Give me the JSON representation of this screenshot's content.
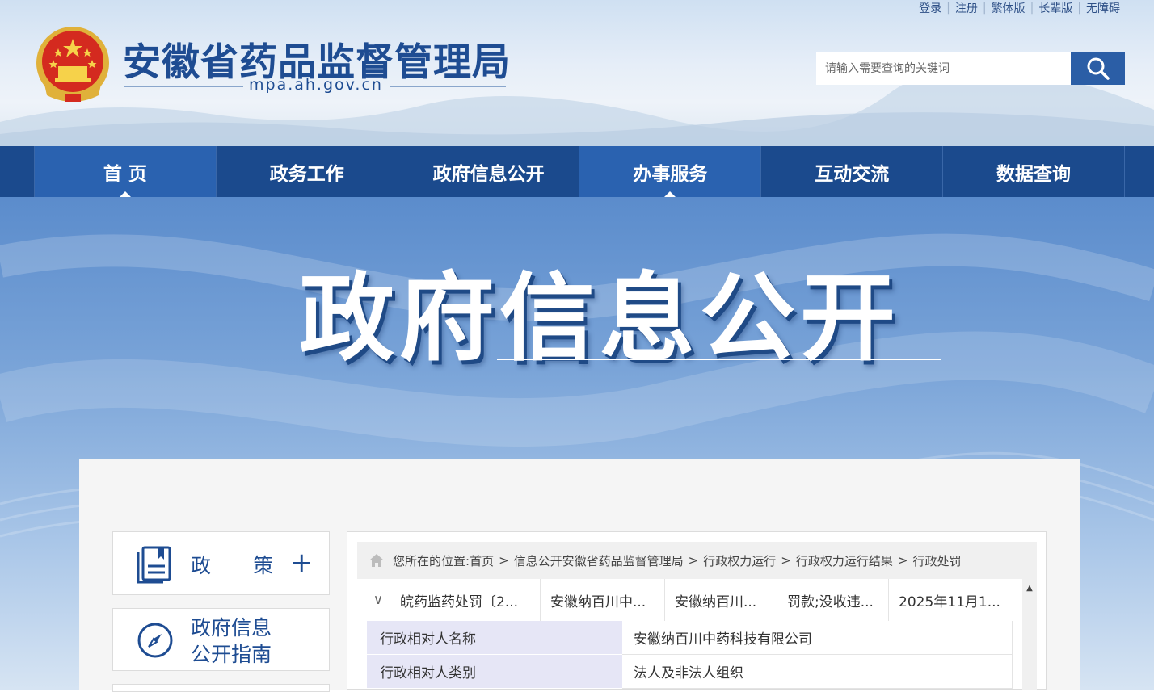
{
  "top_links": [
    "登录",
    "注册",
    "繁体版",
    "长辈版",
    "无障碍"
  ],
  "site": {
    "title": "安徽省药品监督管理局",
    "domain": "mpa.ah.gov.cn"
  },
  "search": {
    "placeholder": "请输入需要查询的关键词",
    "value": ""
  },
  "nav": [
    {
      "label": "首 页",
      "active": true
    },
    {
      "label": "政务工作",
      "active": false
    },
    {
      "label": "政府信息公开",
      "active": false
    },
    {
      "label": "办事服务",
      "active": true
    },
    {
      "label": "互动交流",
      "active": false
    },
    {
      "label": "数据查询",
      "active": false
    }
  ],
  "banner": {
    "title": "政府信息公开"
  },
  "sidebar": {
    "policy_a": "政",
    "policy_b": "策",
    "plus": "+",
    "guide_line1": "政府信息",
    "guide_line2": "公开指南"
  },
  "breadcrumb": {
    "prefix": "您所在的位置:",
    "items": [
      "首页",
      "信息公开安徽省药品监督管理局",
      "行政权力运行",
      "行政权力运行结果",
      "行政处罚"
    ],
    "separator": ">"
  },
  "record": {
    "toggle": "∨",
    "cells": [
      "皖药监药处罚〔2...",
      "安徽纳百川中...",
      "安徽纳百川...",
      "罚款;没收违...",
      "2025年11月1..."
    ],
    "details": [
      {
        "key": "行政相对人名称",
        "value": "安徽纳百川中药科技有限公司"
      },
      {
        "key": "行政相对人类别",
        "value": "法人及非法人组织"
      }
    ]
  },
  "scrollbar": {
    "up_arrow": "▲"
  },
  "colors": {
    "brand_blue": "#1e4c92",
    "nav_bg": "#1b4a8d",
    "nav_active": "#2a62b0",
    "search_btn": "#2b5ea6",
    "detail_key_bg": "#e6e6f6"
  }
}
